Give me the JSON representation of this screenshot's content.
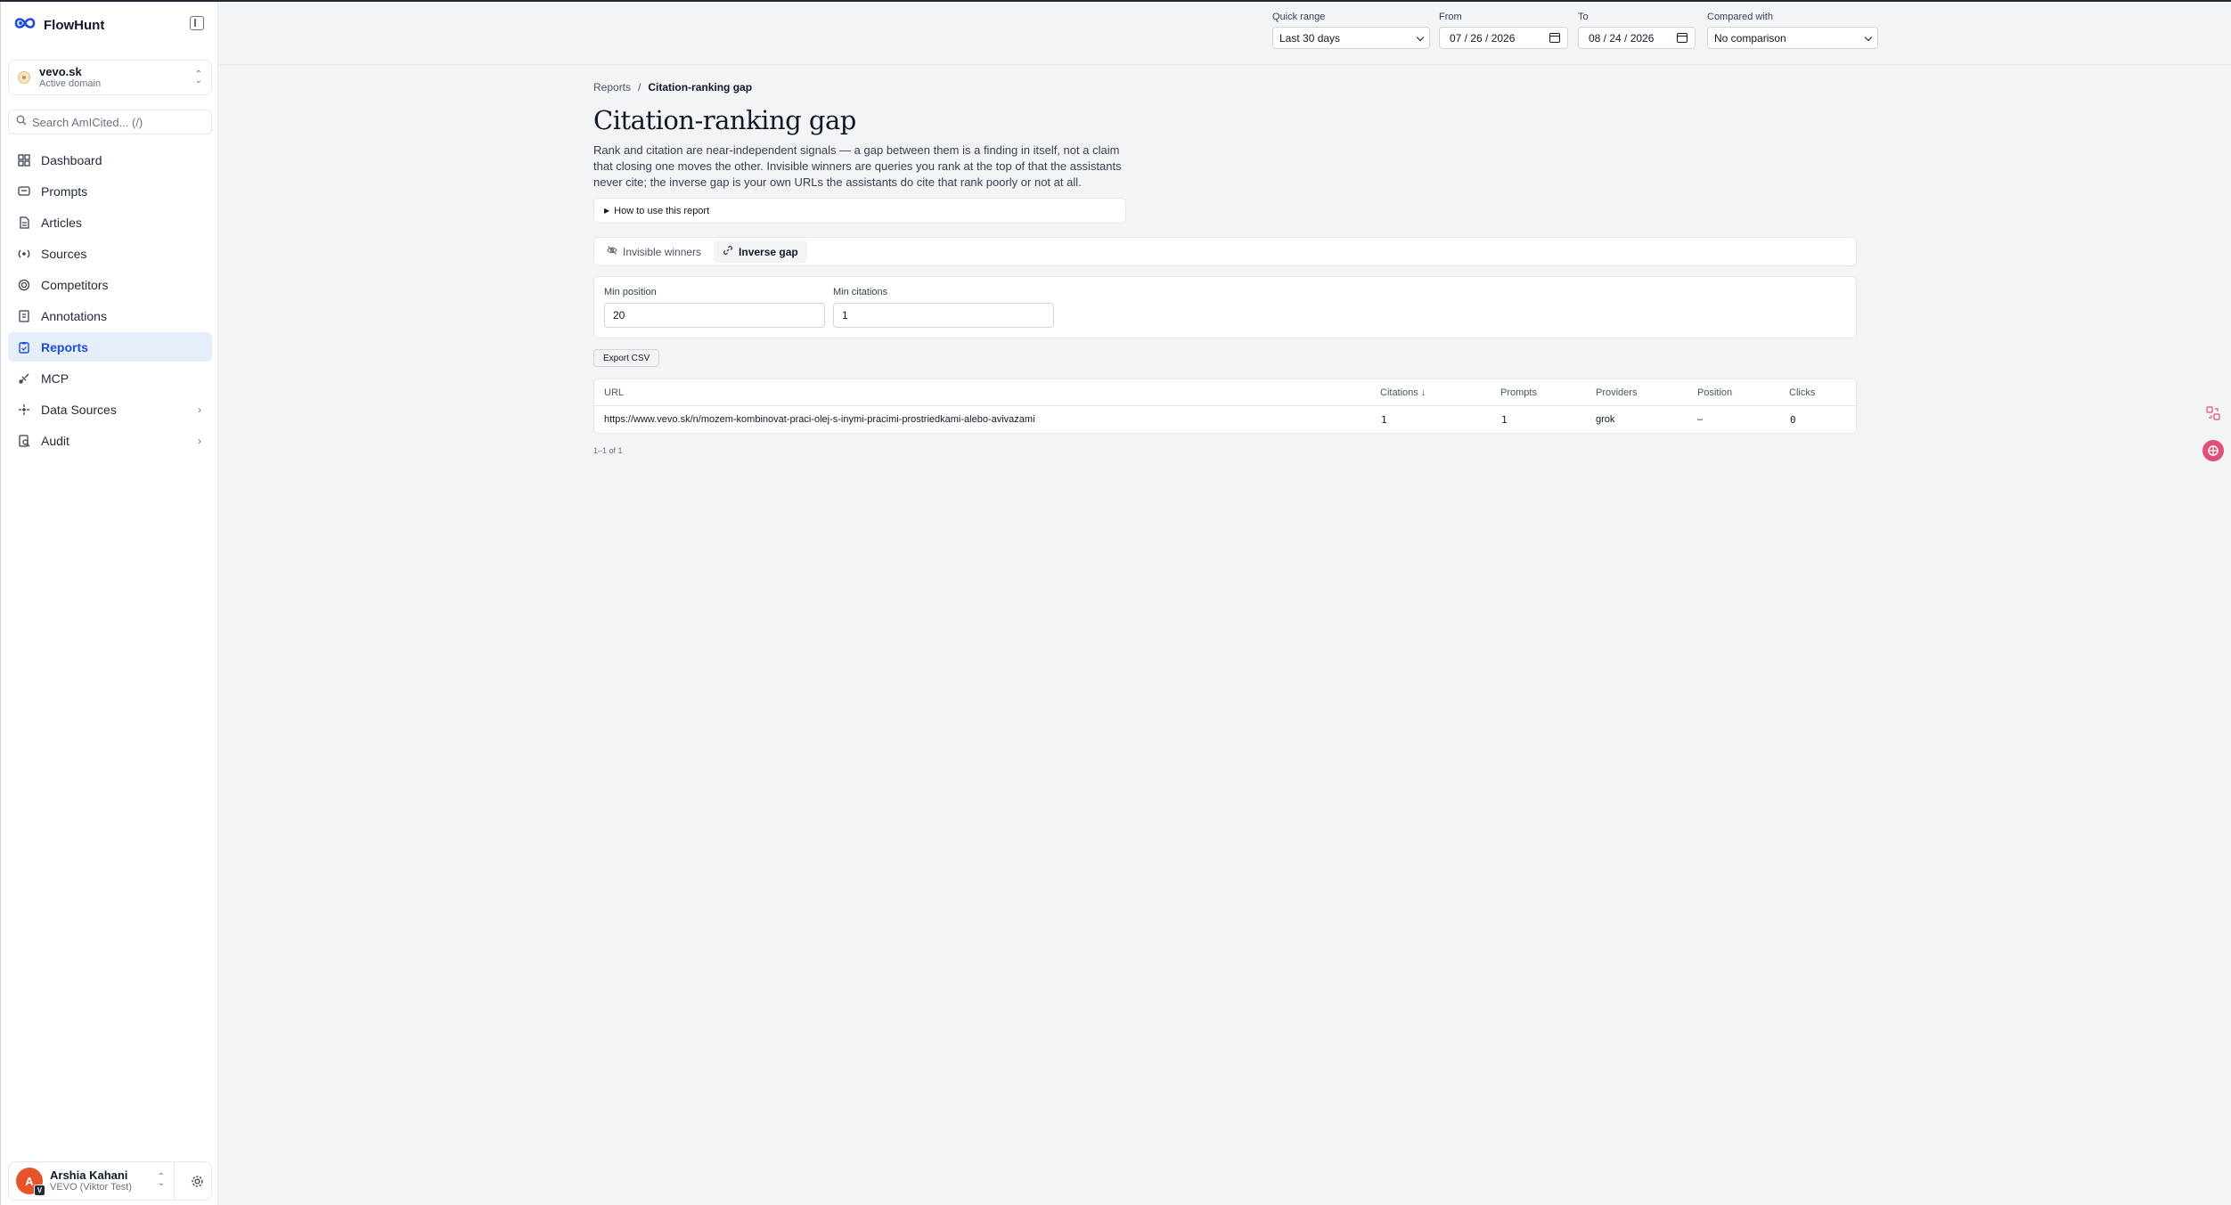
{
  "app": {
    "brand": "FlowHunt"
  },
  "domain": {
    "name": "vevo.sk",
    "sub": "Active domain"
  },
  "search": {
    "placeholder": "Search AmICited... (/)"
  },
  "nav": {
    "items": [
      {
        "label": "Dashboard",
        "icon": "dashboard-icon"
      },
      {
        "label": "Prompts",
        "icon": "prompts-icon"
      },
      {
        "label": "Articles",
        "icon": "articles-icon"
      },
      {
        "label": "Sources",
        "icon": "sources-icon"
      },
      {
        "label": "Competitors",
        "icon": "competitors-icon"
      },
      {
        "label": "Annotations",
        "icon": "annotations-icon"
      },
      {
        "label": "Reports",
        "icon": "reports-icon"
      },
      {
        "label": "MCP",
        "icon": "mcp-icon"
      },
      {
        "label": "Data Sources",
        "icon": "data-sources-icon"
      },
      {
        "label": "Audit",
        "icon": "audit-icon"
      }
    ],
    "active": "Reports"
  },
  "user": {
    "name": "Arshia Kahani",
    "org": "VEVO (Viktor Test)",
    "initial": "A",
    "badge": "V"
  },
  "topbar": {
    "quick_range": {
      "label": "Quick range",
      "value": "Last 30 days"
    },
    "from": {
      "label": "From",
      "value": "07 / 26 / 2026"
    },
    "to": {
      "label": "To",
      "value": "08 / 24 / 2026"
    },
    "compared": {
      "label": "Compared with",
      "value": "No comparison"
    }
  },
  "breadcrumb": {
    "parent": "Reports",
    "separator": "/",
    "current": "Citation-ranking gap"
  },
  "page": {
    "title": "Citation-ranking gap",
    "description": "Rank and citation are near-independent signals — a gap between them is a finding in itself, not a claim that closing one moves the other. Invisible winners are queries you rank at the top of that the assistants never cite; the inverse gap is your own URLs the assistants do cite that rank poorly or not at all.",
    "howto": "How to use this report"
  },
  "tabs": [
    {
      "label": "Invisible winners",
      "icon": "eye-off-icon",
      "active": false
    },
    {
      "label": "Inverse gap",
      "icon": "link-icon",
      "active": true
    }
  ],
  "filters": {
    "min_position": {
      "label": "Min position",
      "value": "20"
    },
    "min_citations": {
      "label": "Min citations",
      "value": "1"
    }
  },
  "export_label": "Export CSV",
  "table": {
    "headers": {
      "url": "URL",
      "citations": "Citations ↓",
      "prompts": "Prompts",
      "providers": "Providers",
      "position": "Position",
      "clicks": "Clicks"
    },
    "rows": [
      {
        "url": "https://www.vevo.sk/n/mozem-kombinovat-praci-olej-s-inymi-pracimi-prostriedkami-alebo-avivazami",
        "citations": "1",
        "prompts": "1",
        "providers": "grok",
        "position": "–",
        "clicks": "0"
      }
    ]
  },
  "pager": "1–1 of 1",
  "colors": {
    "accent": "#1d4ed8",
    "active_bg": "#e6eefb",
    "avatar": "#e8542a"
  }
}
